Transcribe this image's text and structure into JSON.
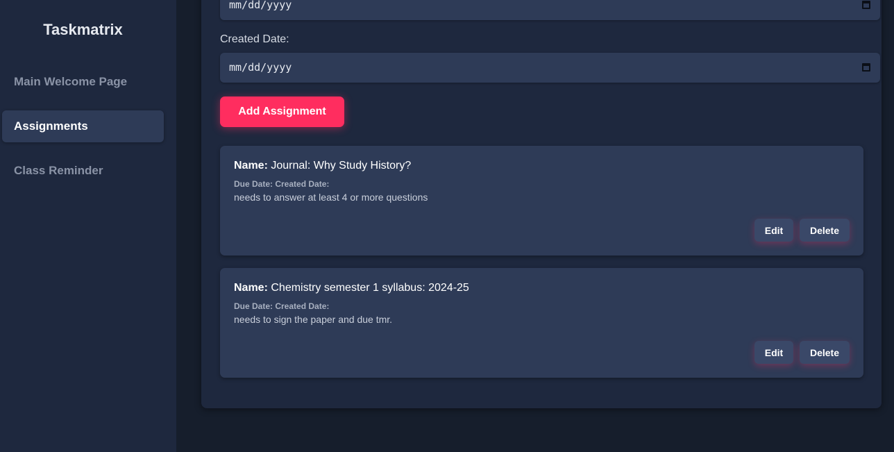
{
  "sidebar": {
    "brand": "Taskmatrix",
    "items": [
      {
        "label": "Main Welcome Page",
        "active": false
      },
      {
        "label": "Assignments",
        "active": true
      },
      {
        "label": "Class Reminder",
        "active": false
      }
    ]
  },
  "form": {
    "due_date": {
      "placeholder": "mm/dd/yyyy"
    },
    "created_date": {
      "label": "Created Date:",
      "placeholder": "mm/dd/yyyy"
    },
    "add_button_label": "Add Assignment"
  },
  "assignments": [
    {
      "name_label": "Name:",
      "name": "Journal: Why Study History?",
      "dates_label": "Due Date: Created Date:",
      "description": "needs to answer at least 4 or more questions",
      "edit_label": "Edit",
      "delete_label": "Delete"
    },
    {
      "name_label": "Name:",
      "name": "Chemistry semester 1 syllabus: 2024-25",
      "dates_label": "Due Date: Created Date:",
      "description": "needs to sign the paper and due tmr.",
      "edit_label": "Edit",
      "delete_label": "Delete"
    }
  ],
  "colors": {
    "accent": "#ff2d5f",
    "panel": "#1e283e",
    "card": "#2e3b57",
    "background": "#161e2c"
  }
}
